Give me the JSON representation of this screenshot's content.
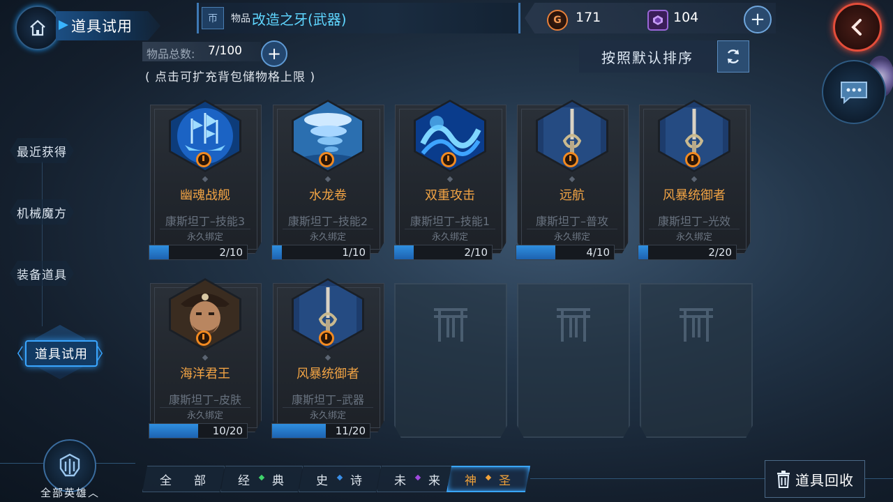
{
  "header": {
    "title": "道具试用",
    "item_prefix": "物品",
    "item_name": "改造之牙(武器)",
    "item_emblem": "帀"
  },
  "currency": {
    "gold_symbol": "G",
    "gold": "171",
    "gems": "104",
    "add_symbol": "+"
  },
  "inventory": {
    "count_label": "物品总数:",
    "count_value": "7/100",
    "expand_symbol": "+",
    "expand_hint": "( 点击可扩充背包储物格上限 )",
    "sort_label": "按照默认排序"
  },
  "sidebar": {
    "items": [
      {
        "label": "最近获得"
      },
      {
        "label": "机械魔方"
      },
      {
        "label": "装备道具"
      },
      {
        "label": "道具试用"
      }
    ],
    "chevron_left": "〈",
    "chevron_right": "〉"
  },
  "cards": [
    {
      "name": "幽魂战舰",
      "hero": "康斯坦丁–技能3",
      "bind": "永久绑定",
      "progress": "2/10",
      "fill": 0.2,
      "icon": "ghost-ship-icon"
    },
    {
      "name": "水龙卷",
      "hero": "康斯坦丁–技能2",
      "bind": "永久绑定",
      "progress": "1/10",
      "fill": 0.1,
      "icon": "water-tornado-icon"
    },
    {
      "name": "双重攻击",
      "hero": "康斯坦丁–技能1",
      "bind": "永久绑定",
      "progress": "2/10",
      "fill": 0.2,
      "icon": "double-attack-icon"
    },
    {
      "name": "远航",
      "hero": "康斯坦丁–普攻",
      "bind": "永久绑定",
      "progress": "4/10",
      "fill": 0.4,
      "icon": "sword-icon"
    },
    {
      "name": "风暴统御者",
      "hero": "康斯坦丁–光效",
      "bind": "永久绑定",
      "progress": "2/20",
      "fill": 0.1,
      "icon": "sword-icon"
    },
    {
      "name": "海洋君王",
      "hero": "康斯坦丁–皮肤",
      "bind": "永久绑定",
      "progress": "10/20",
      "fill": 0.5,
      "icon": "pirate-portrait-icon"
    },
    {
      "name": "风暴统御者",
      "hero": "康斯坦丁–武器",
      "bind": "永久绑定",
      "progress": "11/20",
      "fill": 0.55,
      "icon": "sword-icon"
    }
  ],
  "footer": {
    "hero_filter": "全部英雄",
    "hero_chevron": "︿",
    "filters": [
      {
        "a": "全",
        "b": "部",
        "gem": ""
      },
      {
        "a": "经",
        "b": "典",
        "gem": "#3fd36b"
      },
      {
        "a": "史",
        "b": "诗",
        "gem": "#3a8ee6"
      },
      {
        "a": "未",
        "b": "来",
        "gem": "#a04adf"
      },
      {
        "a": "神",
        "b": "圣",
        "gem": "#f0a23a"
      }
    ],
    "recycle_label": "道具回收"
  },
  "colors": {
    "accent": "#3aa6ff",
    "item_name": "#5fd6ff",
    "card_name": "#f1a344",
    "back_button": "#e44d3a"
  }
}
